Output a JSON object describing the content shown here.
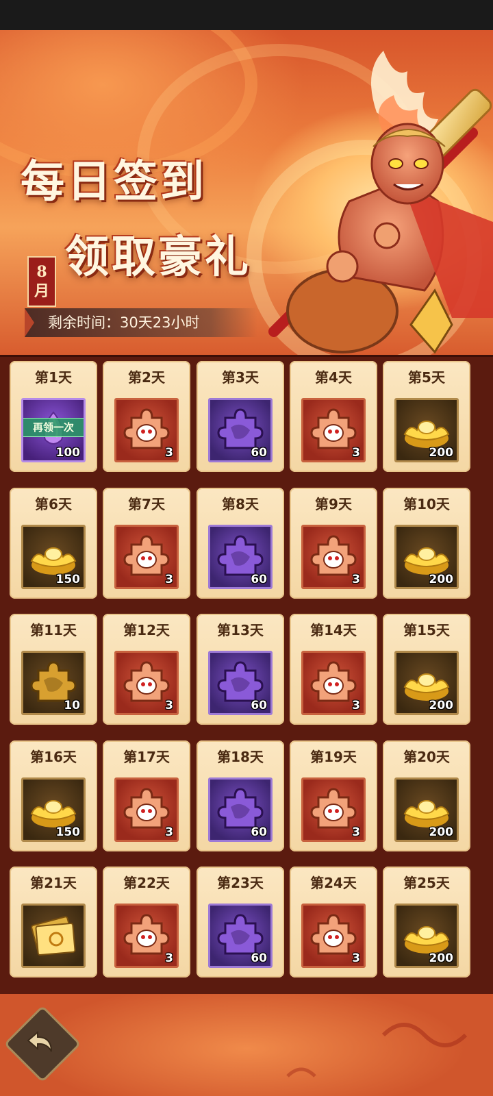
{
  "banner": {
    "title_line1": "每日签到",
    "title_line2": "领取豪礼",
    "month_number": "8",
    "month_unit": "月",
    "remaining_time": "剩余时间：30天23小时"
  },
  "rewards": [
    {
      "label": "第1天",
      "icon": "purple-gem-icon",
      "qty": "100",
      "status": "再领一次"
    },
    {
      "label": "第2天",
      "icon": "red-puzzle-piece-icon",
      "qty": "3"
    },
    {
      "label": "第3天",
      "icon": "purple-puzzle-piece-icon",
      "qty": "60"
    },
    {
      "label": "第4天",
      "icon": "red-puzzle-piece-icon",
      "qty": "3"
    },
    {
      "label": "第5天",
      "icon": "gold-ingot-icon",
      "qty": "200"
    },
    {
      "label": "第6天",
      "icon": "gold-ingot-icon",
      "qty": "150"
    },
    {
      "label": "第7天",
      "icon": "red-puzzle-piece-icon",
      "qty": "3"
    },
    {
      "label": "第8天",
      "icon": "purple-puzzle-piece-icon",
      "qty": "60"
    },
    {
      "label": "第9天",
      "icon": "red-puzzle-piece-icon",
      "qty": "3"
    },
    {
      "label": "第10天",
      "icon": "gold-ingot-icon",
      "qty": "200"
    },
    {
      "label": "第11天",
      "icon": "gold-puzzle-piece-icon",
      "qty": "10"
    },
    {
      "label": "第12天",
      "icon": "red-puzzle-piece-icon",
      "qty": "3"
    },
    {
      "label": "第13天",
      "icon": "purple-puzzle-piece-icon",
      "qty": "60"
    },
    {
      "label": "第14天",
      "icon": "red-puzzle-piece-icon",
      "qty": "3"
    },
    {
      "label": "第15天",
      "icon": "gold-ingot-icon",
      "qty": "200"
    },
    {
      "label": "第16天",
      "icon": "gold-ingot-icon",
      "qty": "150"
    },
    {
      "label": "第17天",
      "icon": "red-puzzle-piece-icon",
      "qty": "3"
    },
    {
      "label": "第18天",
      "icon": "purple-puzzle-piece-icon",
      "qty": "60"
    },
    {
      "label": "第19天",
      "icon": "red-puzzle-piece-icon",
      "qty": "3"
    },
    {
      "label": "第20天",
      "icon": "gold-ingot-icon",
      "qty": "200"
    },
    {
      "label": "第21天",
      "icon": "gold-ticket-icon",
      "qty": ""
    },
    {
      "label": "第22天",
      "icon": "red-puzzle-piece-icon",
      "qty": "3"
    },
    {
      "label": "第23天",
      "icon": "purple-puzzle-piece-icon",
      "qty": "60"
    },
    {
      "label": "第24天",
      "icon": "red-puzzle-piece-icon",
      "qty": "3"
    },
    {
      "label": "第25天",
      "icon": "gold-ingot-icon",
      "qty": "200"
    }
  ],
  "footer": {
    "back_icon": "back-arrow-icon"
  }
}
